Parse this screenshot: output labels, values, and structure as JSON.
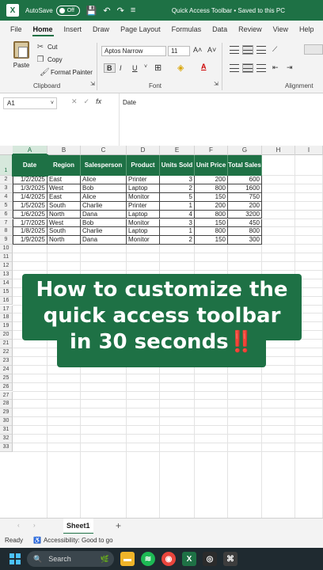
{
  "titlebar": {
    "app_initial": "X",
    "autosave_label": "AutoSave",
    "autosave_state": "Off",
    "document_title": "Quick Access Toolbar • Saved to this PC"
  },
  "tabs": [
    "File",
    "Home",
    "Insert",
    "Draw",
    "Page Layout",
    "Formulas",
    "Data",
    "Review",
    "View",
    "Help"
  ],
  "active_tab": "Home",
  "ribbon": {
    "clipboard": {
      "paste": "Paste",
      "cut": "Cut",
      "copy": "Copy",
      "format_painter": "Format Painter",
      "group_label": "Clipboard"
    },
    "font": {
      "font_name": "Aptos Narrow",
      "font_size": "11",
      "bold": "B",
      "italic": "I",
      "underline": "U",
      "group_label": "Font"
    },
    "alignment": {
      "group_label": "Alignment"
    }
  },
  "formula_bar": {
    "name_box": "A1",
    "fx": "fx",
    "value": "Date"
  },
  "columns": [
    "A",
    "B",
    "C",
    "D",
    "E",
    "F",
    "G",
    "H",
    "I"
  ],
  "rows": [
    "1",
    "2",
    "3",
    "4",
    "5",
    "6",
    "7",
    "8",
    "9",
    "10",
    "11",
    "12",
    "13",
    "14",
    "15",
    "16",
    "17",
    "18",
    "19",
    "20",
    "21",
    "22",
    "23",
    "24",
    "25",
    "26",
    "27",
    "28",
    "29",
    "30",
    "31",
    "32",
    "33"
  ],
  "table": {
    "headers": [
      "Date",
      "Region",
      "Salesperson",
      "Product",
      "Units Sold",
      "Unit Price",
      "Total Sales"
    ],
    "rows": [
      [
        "1/2/2025",
        "East",
        "Alice",
        "Printer",
        "3",
        "200",
        "600"
      ],
      [
        "1/3/2025",
        "West",
        "Bob",
        "Laptop",
        "2",
        "800",
        "1600"
      ],
      [
        "1/4/2025",
        "East",
        "Alice",
        "Monitor",
        "5",
        "150",
        "750"
      ],
      [
        "1/5/2025",
        "South",
        "Charlie",
        "Printer",
        "1",
        "200",
        "200"
      ],
      [
        "1/6/2025",
        "North",
        "Dana",
        "Laptop",
        "4",
        "800",
        "3200"
      ],
      [
        "1/7/2025",
        "West",
        "Bob",
        "Monitor",
        "3",
        "150",
        "450"
      ],
      [
        "1/8/2025",
        "South",
        "Charlie",
        "Laptop",
        "1",
        "800",
        "800"
      ],
      [
        "1/9/2025",
        "North",
        "Dana",
        "Monitor",
        "2",
        "150",
        "300"
      ]
    ]
  },
  "overlay": {
    "line1": "How to customize the",
    "line2": "quick access toolbar",
    "line3": "in 30 seconds",
    "emoji": "‼️"
  },
  "sheet_tab": "Sheet1",
  "add_sheet": "+",
  "status": {
    "ready": "Ready",
    "accessibility": "Accessibility: Good to go"
  },
  "taskbar": {
    "search": "Search"
  },
  "colors": {
    "excel_green": "#1e7145",
    "taskbar": "#1f2a30"
  }
}
